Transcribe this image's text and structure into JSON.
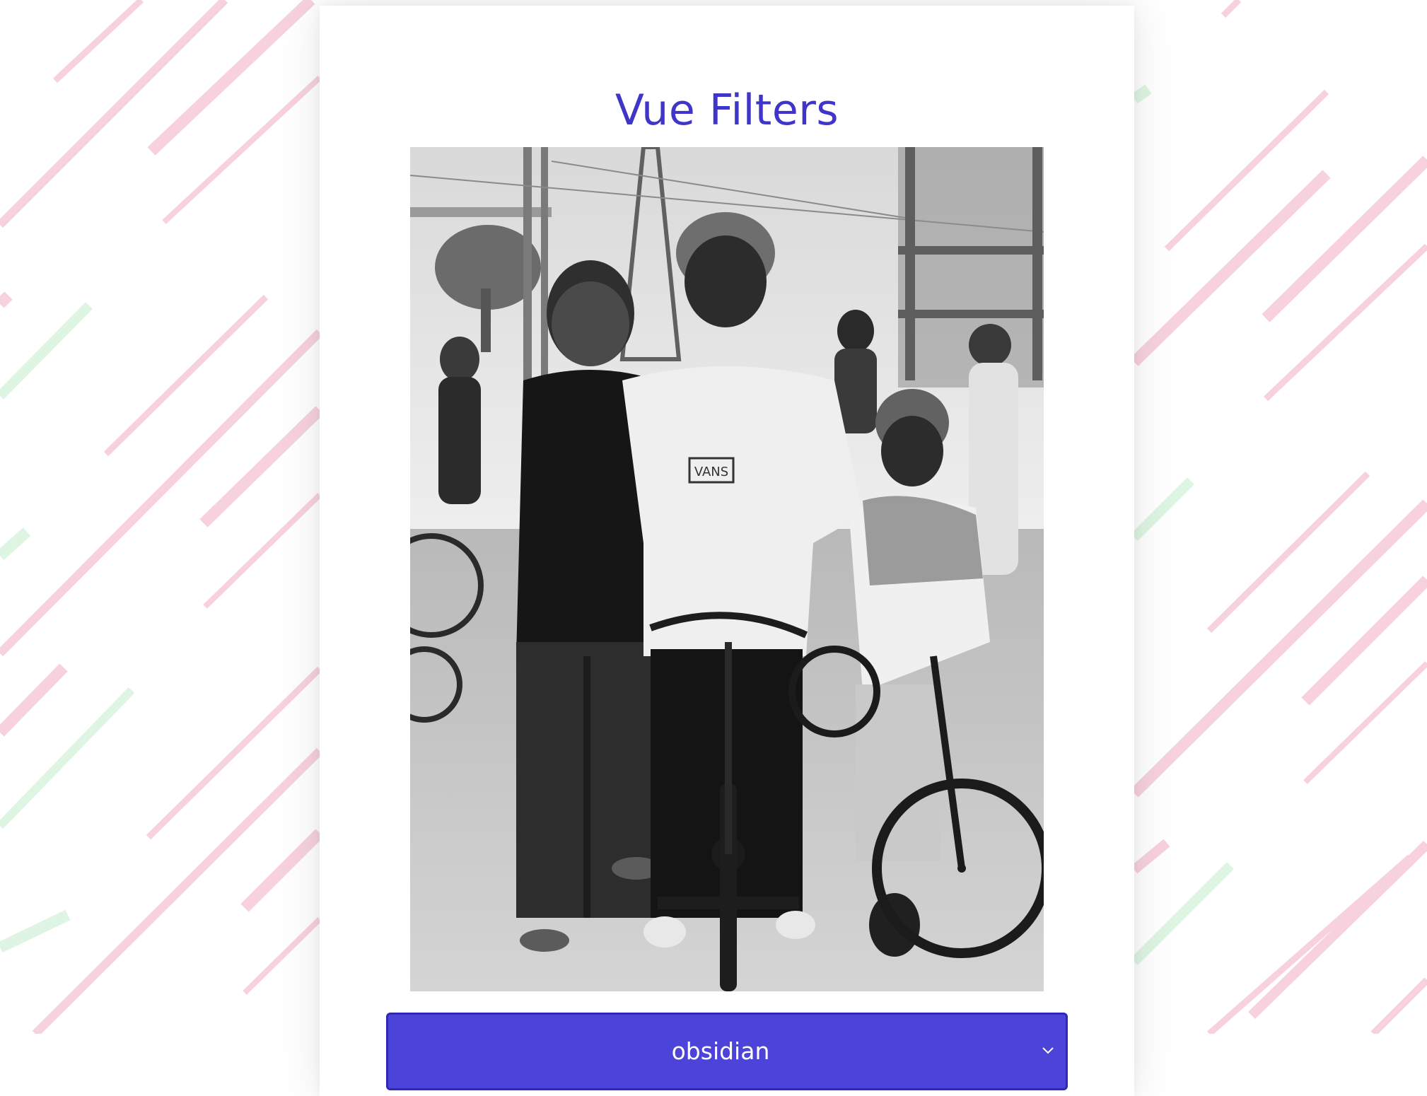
{
  "app": {
    "title": "Vue Filters"
  },
  "photo": {
    "icon": "photo-image",
    "description_visible": false,
    "shirt_print": "VANS"
  },
  "filter_select": {
    "selected": "obsidian",
    "icon": "chevron-down-icon"
  },
  "colors": {
    "title": "#3f35c9",
    "select_bg": "#4c44d9",
    "select_border": "#3127b6",
    "stripe_pink": "#f7d2de",
    "stripe_green": "#dff5e4"
  }
}
